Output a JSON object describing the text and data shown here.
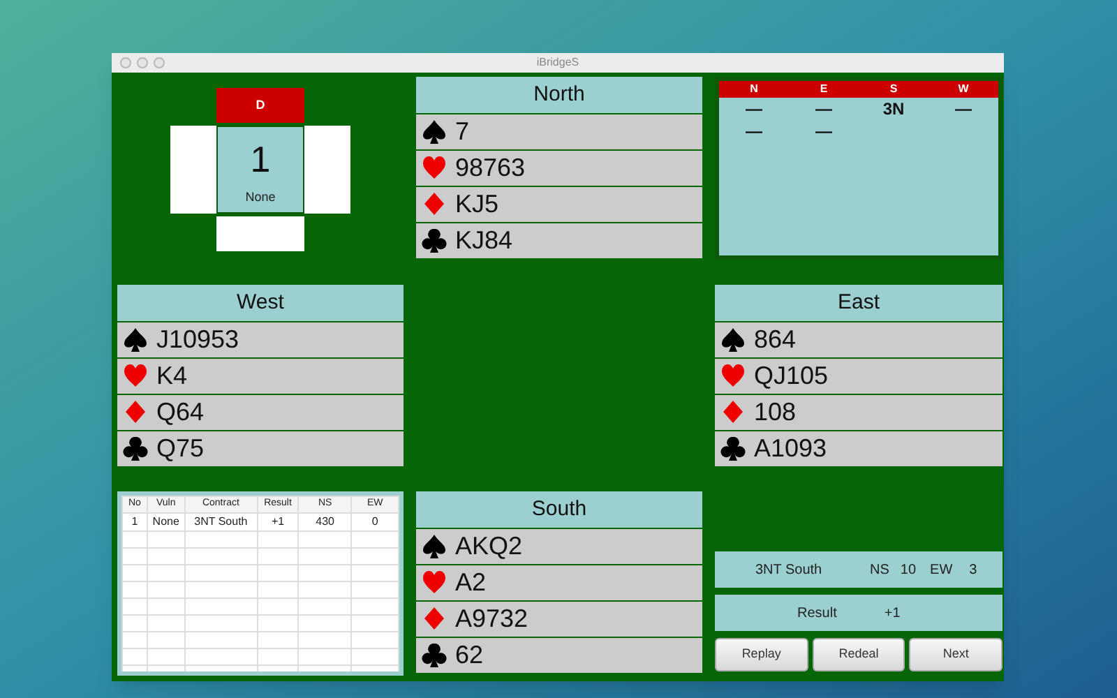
{
  "window": {
    "title": "iBridgeS"
  },
  "dealer_box": {
    "dealer": "D",
    "board": "1",
    "vulnerability": "None"
  },
  "hands": [
    {
      "seat": "North",
      "suits": [
        {
          "kind": "spades",
          "cards": "7"
        },
        {
          "kind": "hearts",
          "cards": "98763"
        },
        {
          "kind": "diamonds",
          "cards": "KJ5"
        },
        {
          "kind": "clubs",
          "cards": "KJ84"
        }
      ]
    },
    {
      "seat": "West",
      "suits": [
        {
          "kind": "spades",
          "cards": "J10953"
        },
        {
          "kind": "hearts",
          "cards": "K4"
        },
        {
          "kind": "diamonds",
          "cards": "Q64"
        },
        {
          "kind": "clubs",
          "cards": "Q75"
        }
      ]
    },
    {
      "seat": "East",
      "suits": [
        {
          "kind": "spades",
          "cards": "864"
        },
        {
          "kind": "hearts",
          "cards": "QJ105"
        },
        {
          "kind": "diamonds",
          "cards": "108"
        },
        {
          "kind": "clubs",
          "cards": "A1093"
        }
      ]
    },
    {
      "seat": "South",
      "suits": [
        {
          "kind": "spades",
          "cards": "AKQ2"
        },
        {
          "kind": "hearts",
          "cards": "A2"
        },
        {
          "kind": "diamonds",
          "cards": "A9732"
        },
        {
          "kind": "clubs",
          "cards": "62"
        }
      ]
    }
  ],
  "bidding": {
    "columns": [
      "N",
      "E",
      "S",
      "W"
    ],
    "rows": [
      [
        "—",
        "—",
        "3N",
        "—"
      ],
      [
        "—",
        "—"
      ]
    ]
  },
  "score_table": {
    "columns": [
      "No",
      "Vuln",
      "Contract",
      "Result",
      "NS",
      "EW"
    ],
    "rows": [
      [
        "1",
        "None",
        "3NT South",
        "+1",
        "430",
        "0"
      ]
    ]
  },
  "contract": {
    "contract": "3NT South",
    "ns_label": "NS",
    "ns_tricks": "10",
    "ew_label": "EW",
    "ew_tricks": "3"
  },
  "result": {
    "label": "Result",
    "value": "+1"
  },
  "buttons": [
    "Replay",
    "Redeal",
    "Next"
  ]
}
